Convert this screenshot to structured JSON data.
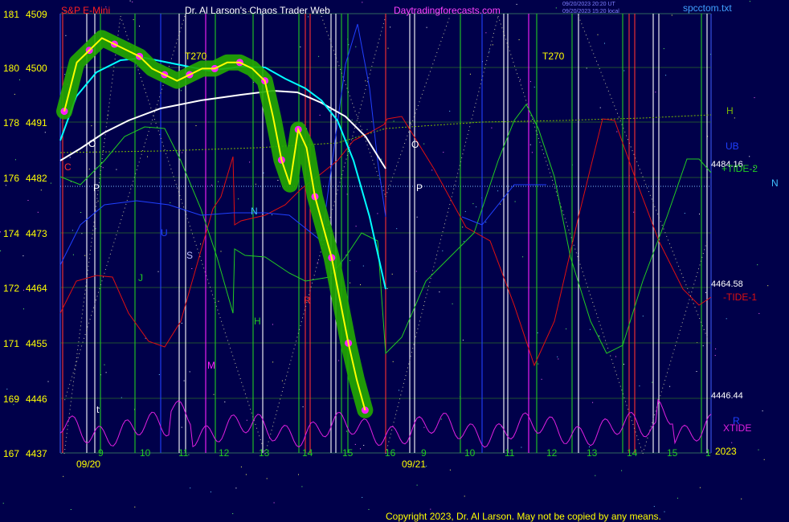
{
  "header": {
    "title_left": "S&P E-Mini",
    "title_main": "Dr. Al Larson's Chaos Trader Web",
    "site": "Daytradingforecasts.com",
    "stamp1": "09/20/2023 20:20 UT",
    "stamp2": "09/20/2023 15:20 local",
    "file": "spcctom.txt"
  },
  "copyright": "Copyright 2023, Dr. Al Larson. May not be copied by any means.",
  "colors": {
    "background": "#00004a",
    "grid": "#2a6a2a",
    "price": "#ffff00",
    "bands": "#22aa00",
    "cyan_ma": "#00ffff",
    "white_ma": "#ffffff",
    "tide1": "#e01010",
    "tide2": "#22cc22",
    "xtide": "#e020e0",
    "blue_line": "#2040ff",
    "h_line": "#7ab800",
    "n_line": "#40c0ff",
    "dots": "#ff20ff"
  },
  "chart_data": {
    "type": "line",
    "title": "S&P E-Mini",
    "y_left_labels": [
      "181",
      "180",
      "178",
      "176",
      "174",
      "172",
      "171",
      "169",
      "167"
    ],
    "y_right_labels": [
      "4509",
      "4500",
      "4491",
      "4482",
      "4473",
      "4464",
      "4455",
      "4446",
      "4437"
    ],
    "ylim": [
      4437,
      4509
    ],
    "x_hour_labels": [
      "9",
      "10",
      "11",
      "12",
      "13",
      "14",
      "15",
      "16",
      "9",
      "10",
      "11",
      "12",
      "13",
      "14",
      "15",
      "1"
    ],
    "x_date_labels": [
      "09/20",
      "09/21"
    ],
    "year_label": "2023",
    "right_values": [
      {
        "label": "4484.16",
        "value": 4484.16
      },
      {
        "label": "4464.58",
        "value": 4464.58
      },
      {
        "label": "4446.44",
        "value": 4446.44
      }
    ],
    "line_labels": [
      "H",
      "UB",
      "+TIDE-2",
      "N",
      "-TIDE-1",
      "XTIDE",
      "T270",
      "T270",
      "R"
    ],
    "chart_letters": [
      "C",
      "P",
      "O",
      "N",
      "S",
      "J",
      "U",
      "H",
      "M",
      "R",
      "O",
      "P",
      "t"
    ],
    "price_series": [
      {
        "t": 0.0,
        "v": 4493
      },
      {
        "t": 0.3,
        "v": 4501
      },
      {
        "t": 0.6,
        "v": 4503
      },
      {
        "t": 0.9,
        "v": 4505
      },
      {
        "t": 1.2,
        "v": 4504
      },
      {
        "t": 1.5,
        "v": 4503
      },
      {
        "t": 1.8,
        "v": 4502
      },
      {
        "t": 2.1,
        "v": 4500
      },
      {
        "t": 2.4,
        "v": 4499
      },
      {
        "t": 2.7,
        "v": 4498
      },
      {
        "t": 3.0,
        "v": 4499
      },
      {
        "t": 3.3,
        "v": 4500
      },
      {
        "t": 3.6,
        "v": 4500
      },
      {
        "t": 3.9,
        "v": 4501
      },
      {
        "t": 4.2,
        "v": 4501
      },
      {
        "t": 4.5,
        "v": 4500
      },
      {
        "t": 4.8,
        "v": 4498
      },
      {
        "t": 5.0,
        "v": 4492
      },
      {
        "t": 5.2,
        "v": 4485
      },
      {
        "t": 5.4,
        "v": 4481
      },
      {
        "t": 5.6,
        "v": 4490
      },
      {
        "t": 5.8,
        "v": 4487
      },
      {
        "t": 6.0,
        "v": 4479
      },
      {
        "t": 6.2,
        "v": 4474
      },
      {
        "t": 6.4,
        "v": 4469
      },
      {
        "t": 6.6,
        "v": 4462
      },
      {
        "t": 6.8,
        "v": 4455
      },
      {
        "t": 7.0,
        "v": 4449
      },
      {
        "t": 7.2,
        "v": 4444
      }
    ],
    "grid": true
  }
}
